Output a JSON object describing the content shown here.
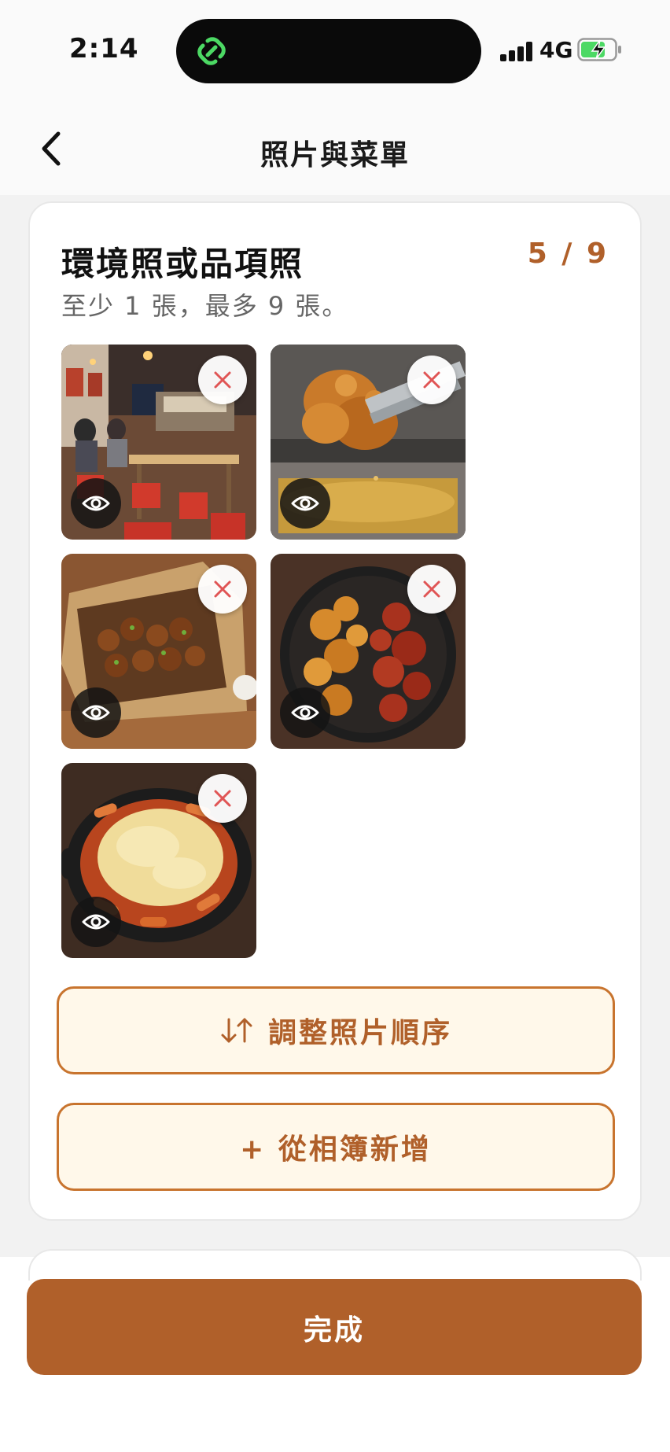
{
  "status_bar": {
    "time": "2:14",
    "network": "4G",
    "icons": [
      "app-logo-icon",
      "signal-icon",
      "battery-charging-icon"
    ]
  },
  "nav": {
    "title": "照片與菜單",
    "back_icon": "chevron-left-icon"
  },
  "section": {
    "title": "環境照或品項照",
    "counter": "5 / 9",
    "subtitle": "至少 1 張，最多 9 張。"
  },
  "photos": [
    {
      "subject": "restaurant-interior",
      "delete_icon": "close-icon",
      "view_icon": "eye-icon"
    },
    {
      "subject": "fried-chicken-tongs",
      "delete_icon": "close-icon",
      "view_icon": "eye-icon"
    },
    {
      "subject": "chicken-takeout-box",
      "delete_icon": "close-icon",
      "view_icon": "eye-icon"
    },
    {
      "subject": "half-half-chicken",
      "delete_icon": "close-icon",
      "view_icon": "eye-icon"
    },
    {
      "subject": "cheese-tteokbokki",
      "delete_icon": "close-icon",
      "view_icon": "eye-icon"
    }
  ],
  "buttons": {
    "reorder_label": "調整照片順序",
    "reorder_icon": "sort-arrows-icon",
    "add_label": "+ 從相簿新增",
    "done_label": "完成"
  },
  "colors": {
    "accent": "#b0602a",
    "outline_button_bg": "#fff8ea",
    "outline_button_border": "#c8742e",
    "delete_x": "#e05555"
  }
}
